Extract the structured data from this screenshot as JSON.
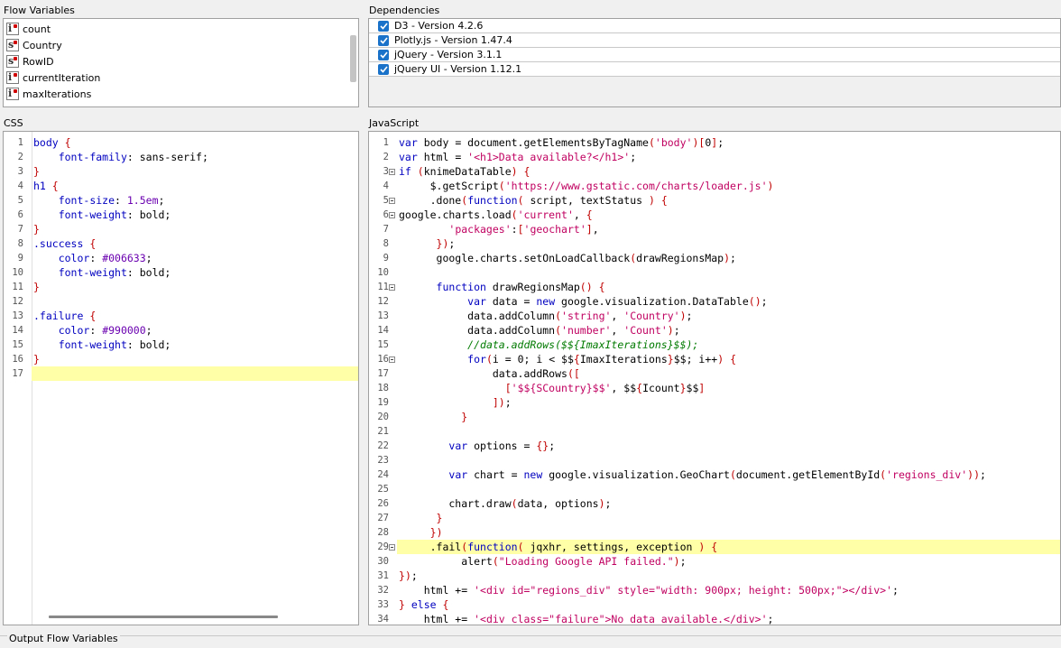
{
  "flow_variables": {
    "title": "Flow Variables",
    "items": [
      {
        "type": "i",
        "label": "count"
      },
      {
        "type": "s",
        "label": "Country"
      },
      {
        "type": "s",
        "label": "RowID"
      },
      {
        "type": "i",
        "label": "currentIteration"
      },
      {
        "type": "i",
        "label": "maxIterations"
      }
    ]
  },
  "dependencies": {
    "title": "Dependencies",
    "items": [
      {
        "label": "D3 - Version 4.2.6",
        "checked": true
      },
      {
        "label": "Plotly.js - Version 1.47.4",
        "checked": true
      },
      {
        "label": "jQuery - Version 3.1.1",
        "checked": true
      },
      {
        "label": "jQuery UI - Version 1.12.1",
        "checked": true
      }
    ]
  },
  "css_editor": {
    "title": "CSS",
    "lines": [
      "body {",
      "    font-family: sans-serif;",
      "}",
      "h1 {",
      "    font-size: 1.5em;",
      "    font-weight: bold;",
      "}",
      ".success {",
      "    color: #006633;",
      "    font-weight: bold;",
      "}",
      "",
      ".failure {",
      "    color: #990000;",
      "    font-weight: bold;",
      "}",
      ""
    ]
  },
  "js_editor": {
    "title": "JavaScript",
    "lines": [
      "var body = document.getElementsByTagName('body')[0];",
      "var html = '<h1>Data available?</h1>';",
      "if (knimeDataTable) {",
      "     $.getScript('https://www.gstatic.com/charts/loader.js')",
      "     .done(function( script, textStatus ) {",
      "google.charts.load('current', {",
      "        'packages':['geochart'],",
      "      });",
      "      google.charts.setOnLoadCallback(drawRegionsMap);",
      "",
      "      function drawRegionsMap() {",
      "           var data = new google.visualization.DataTable();",
      "           data.addColumn('string', 'Country');",
      "           data.addColumn('number', 'Count');",
      "           //data.addRows($${ImaxIterations}$$);",
      "           for(i = 0; i < $${ImaxIterations}$$; i++) {",
      "               data.addRows([",
      "                 ['$${SCountry}$$', $${Icount}$$]",
      "               ]);",
      "          }",
      "",
      "        var options = {};",
      "",
      "        var chart = new google.visualization.GeoChart(document.getElementById('regions_div'));",
      "",
      "        chart.draw(data, options);",
      "      }",
      "     })",
      "     .fail(function( jqxhr, settings, exception ) {",
      "          alert(\"Loading Google API failed.\");",
      "});",
      "    html += '<div id=\"regions_div\" style=\"width: 900px; height: 500px;\"></div>';",
      "} else {",
      "    html += '<div class=\"failure\">No data available.</div>';"
    ]
  },
  "output_flow_variables": {
    "title": "Output Flow Variables"
  },
  "colors": {
    "accent": "#1a73c8",
    "highlight_line": "#ffffa8"
  }
}
